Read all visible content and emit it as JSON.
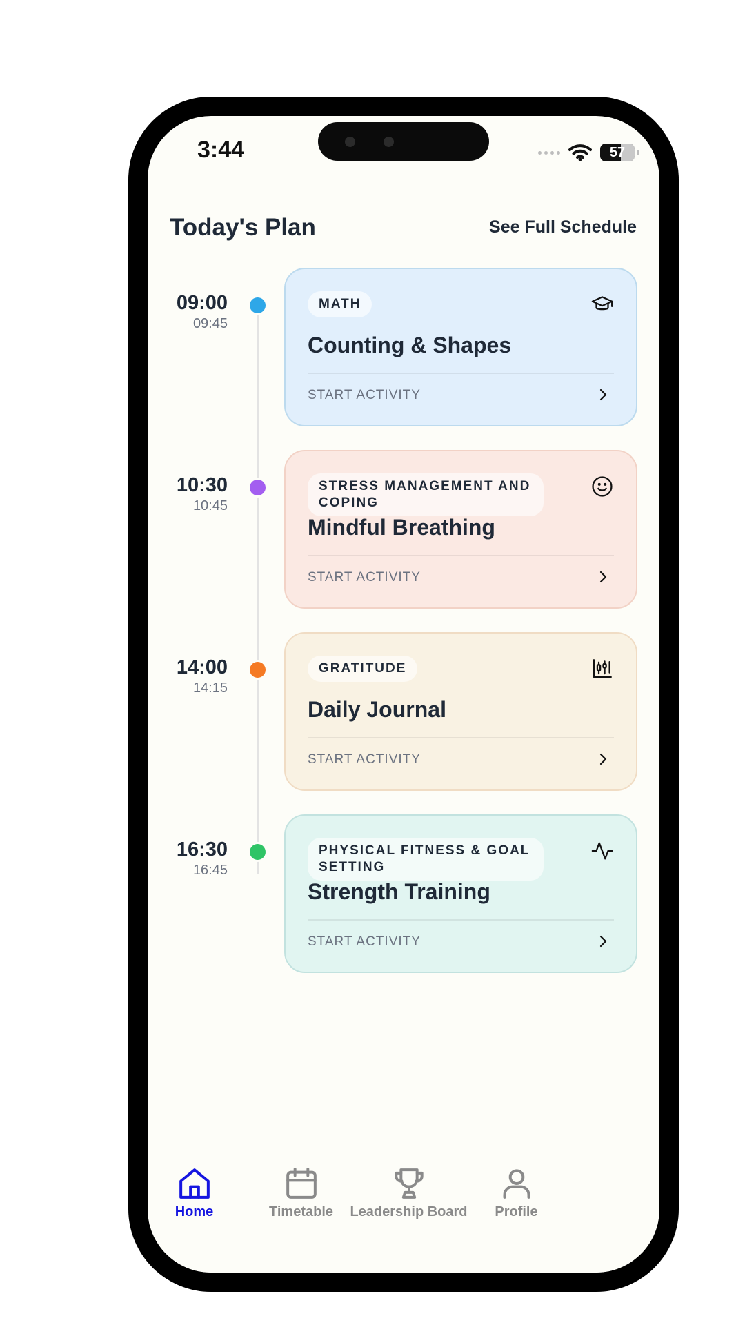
{
  "status_bar": {
    "time": "3:44",
    "battery": "57"
  },
  "header": {
    "title": "Today's Plan",
    "link": "See Full Schedule"
  },
  "activities": [
    {
      "start": "09:00",
      "end": "09:45",
      "category": "MATH",
      "title": "Counting & Shapes",
      "action": "START ACTIVITY",
      "icon": "graduation-cap-icon",
      "dot_color": "#2ea7e8",
      "card_bg": "#e1effc",
      "card_border": "#bcdaee"
    },
    {
      "start": "10:30",
      "end": "10:45",
      "category": "STRESS MANAGEMENT AND COPING",
      "title": "Mindful Breathing",
      "action": "START ACTIVITY",
      "icon": "smile-icon",
      "dot_color": "#a35ef0",
      "card_bg": "#fbe9e3",
      "card_border": "#f2d2c6"
    },
    {
      "start": "14:00",
      "end": "14:15",
      "category": "GRATITUDE",
      "title": "Daily Journal",
      "action": "START ACTIVITY",
      "icon": "chart-candles-icon",
      "dot_color": "#f57a24",
      "card_bg": "#f9f2e3",
      "card_border": "#f0dcc4"
    },
    {
      "start": "16:30",
      "end": "16:45",
      "category": "PHYSICAL FITNESS & GOAL SETTING",
      "title": "Strength Training",
      "action": "START ACTIVITY",
      "icon": "activity-pulse-icon",
      "dot_color": "#2fc466",
      "card_bg": "#e1f5f1",
      "card_border": "#c2e2df"
    }
  ],
  "tabbar": {
    "active": "Home",
    "items": [
      {
        "label": "Home",
        "icon": "home-icon"
      },
      {
        "label": "Timetable",
        "icon": "calendar-icon"
      },
      {
        "label": "Leadership Board",
        "icon": "trophy-icon"
      },
      {
        "label": "Profile",
        "icon": "user-icon"
      }
    ]
  }
}
